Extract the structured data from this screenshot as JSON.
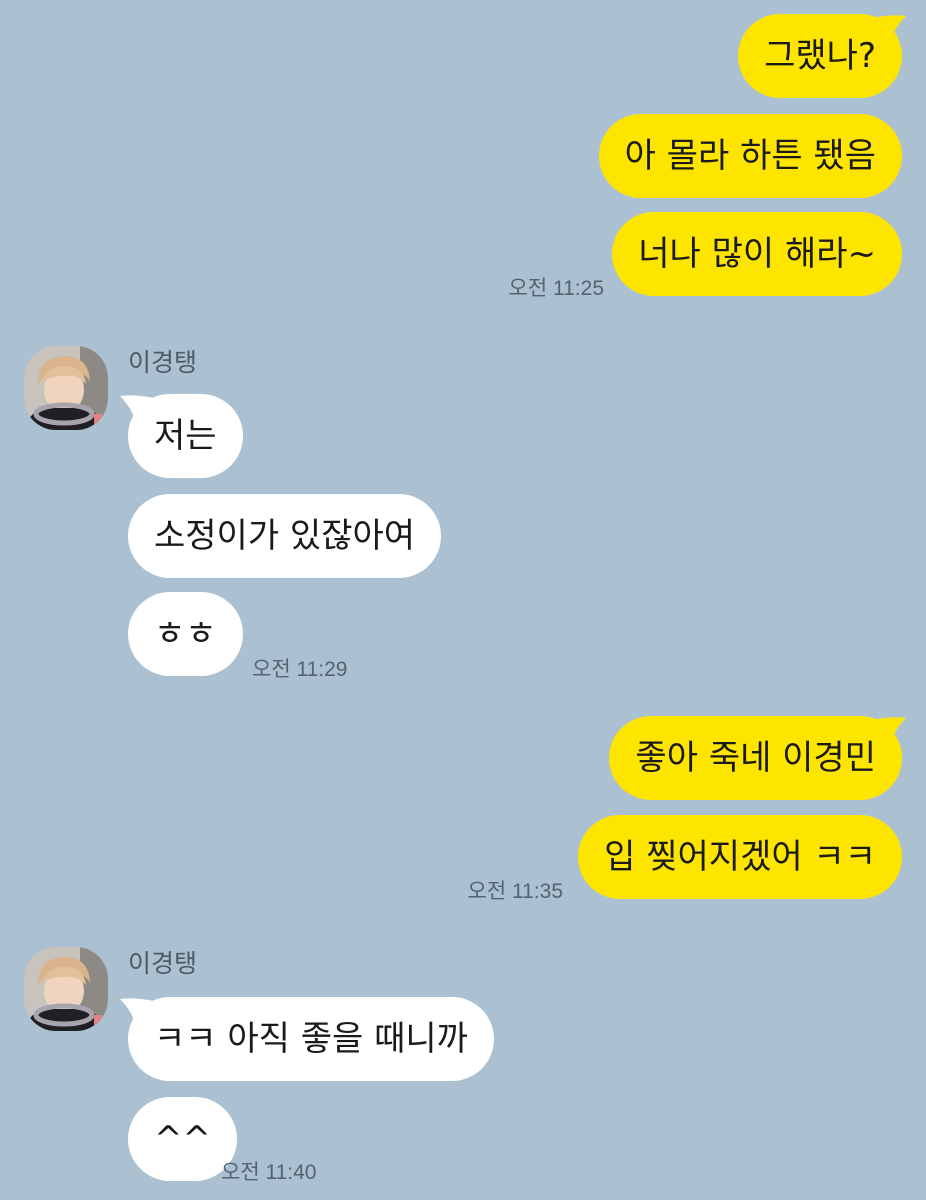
{
  "conversation": {
    "block1": {
      "sender": "me",
      "messages": [
        "그랬나?",
        "아 몰라 하튼 됐음",
        "너나 많이 해라~"
      ],
      "time": "오전 11:25"
    },
    "block2": {
      "sender_name": "이경탱",
      "messages": [
        "저는",
        "소정이가 있잖아여",
        "ㅎㅎ"
      ],
      "time": "오전 11:29"
    },
    "block3": {
      "sender": "me",
      "messages": [
        "좋아 죽네 이경민",
        "입 찢어지겠어 ㅋㅋ"
      ],
      "time": "오전 11:35"
    },
    "block4": {
      "sender_name": "이경탱",
      "messages": [
        "ㅋㅋ 아직 좋을 때니까",
        "^^"
      ],
      "time": "오전 11:40"
    }
  },
  "colors": {
    "background": "#abc1d1",
    "outgoing_bubble": "#fee500",
    "incoming_bubble": "#ffffff",
    "timestamp_text": "#556270"
  },
  "icons": {
    "avatar": "profile-photo"
  }
}
